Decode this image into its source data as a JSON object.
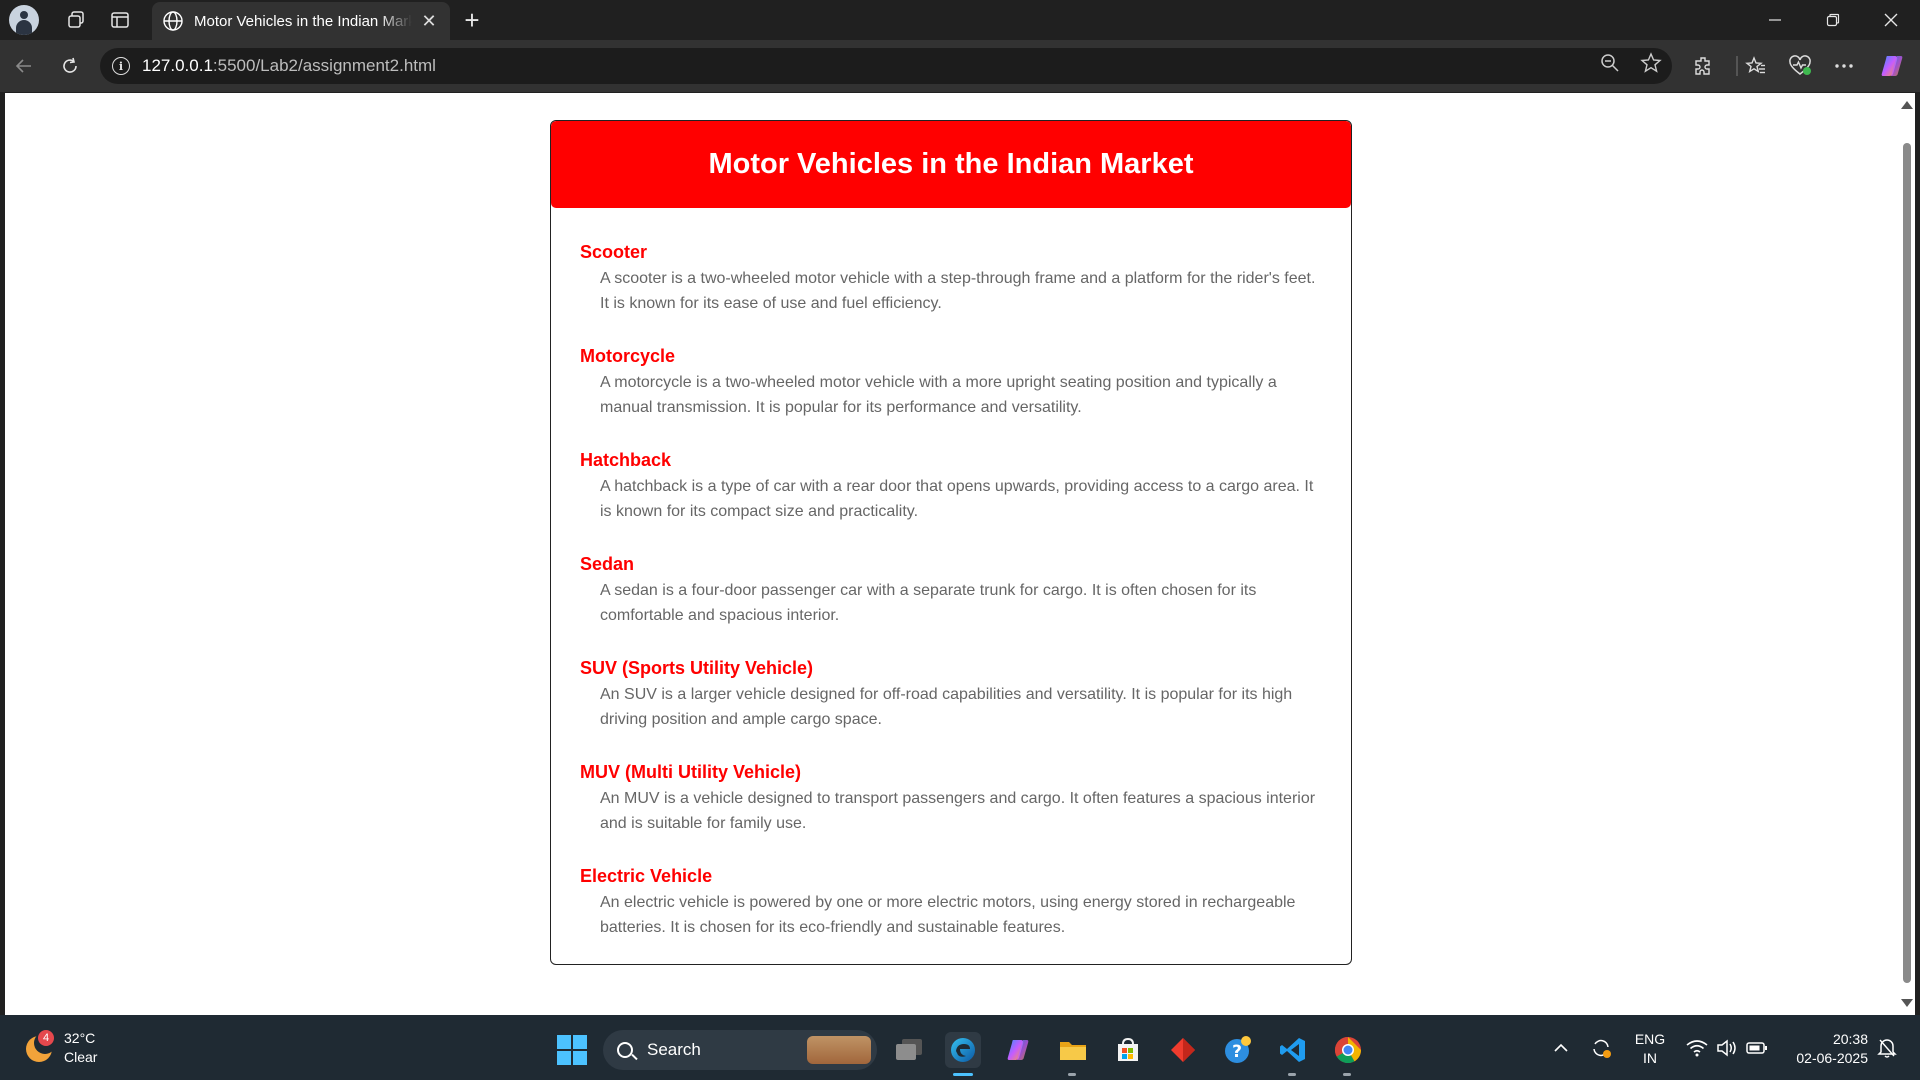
{
  "browser": {
    "tab_title": "Motor Vehicles in the Indian Market",
    "tab_close": "✕",
    "new_tab": "+",
    "url_host": "127.0.0.1",
    "url_path": ":5500/Lab2/assignment2.html",
    "info_glyph": "i",
    "icons": [
      "profile-avatar",
      "workspaces-icon",
      "vertical-tabs-icon",
      "globe-icon",
      "back-icon",
      "refresh-icon",
      "zoom-icon",
      "favorite-star-icon",
      "extensions-icon",
      "favorites-icon",
      "browser-essentials-icon",
      "more-icon",
      "copilot-icon"
    ]
  },
  "page": {
    "header_title": "Motor Vehicles in the Indian Market",
    "accent_color": "#ff0000",
    "items": [
      {
        "title": "Scooter",
        "desc": "A scooter is a two-wheeled motor vehicle with a step-through frame and a platform for the rider's feet. It is known for its ease of use and fuel efficiency."
      },
      {
        "title": "Motorcycle",
        "desc": "A motorcycle is a two-wheeled motor vehicle with a more upright seating position and typically a manual transmission. It is popular for its performance and versatility."
      },
      {
        "title": "Hatchback",
        "desc": "A hatchback is a type of car with a rear door that opens upwards, providing access to a cargo area. It is known for its compact size and practicality."
      },
      {
        "title": "Sedan",
        "desc": "A sedan is a four-door passenger car with a separate trunk for cargo. It is often chosen for its comfortable and spacious interior."
      },
      {
        "title": "SUV (Sports Utility Vehicle)",
        "desc": "An SUV is a larger vehicle designed for off-road capabilities and versatility. It is popular for its high driving position and ample cargo space."
      },
      {
        "title": "MUV (Multi Utility Vehicle)",
        "desc": "An MUV is a vehicle designed to transport passengers and cargo. It often features a spacious interior and is suitable for family use."
      },
      {
        "title": "Electric Vehicle",
        "desc": "An electric vehicle is powered by one or more electric motors, using energy stored in rechargeable batteries. It is chosen for its eco-friendly and sustainable features."
      }
    ]
  },
  "taskbar": {
    "weather_temp": "32°C",
    "weather_desc": "Clear",
    "weather_badge": "4",
    "search_label": "Search",
    "lang_top": "ENG",
    "lang_bottom": "IN",
    "time": "20:38",
    "date": "02-06-2025",
    "icons": [
      "start-icon",
      "task-view-icon",
      "edge-icon",
      "copilot-icon",
      "file-explorer-icon",
      "store-icon",
      "git-icon",
      "help-icon",
      "vscode-icon",
      "chrome-icon",
      "chevron-up-icon",
      "sync-icon",
      "wifi-icon",
      "volume-icon",
      "battery-icon",
      "notification-icon"
    ]
  }
}
